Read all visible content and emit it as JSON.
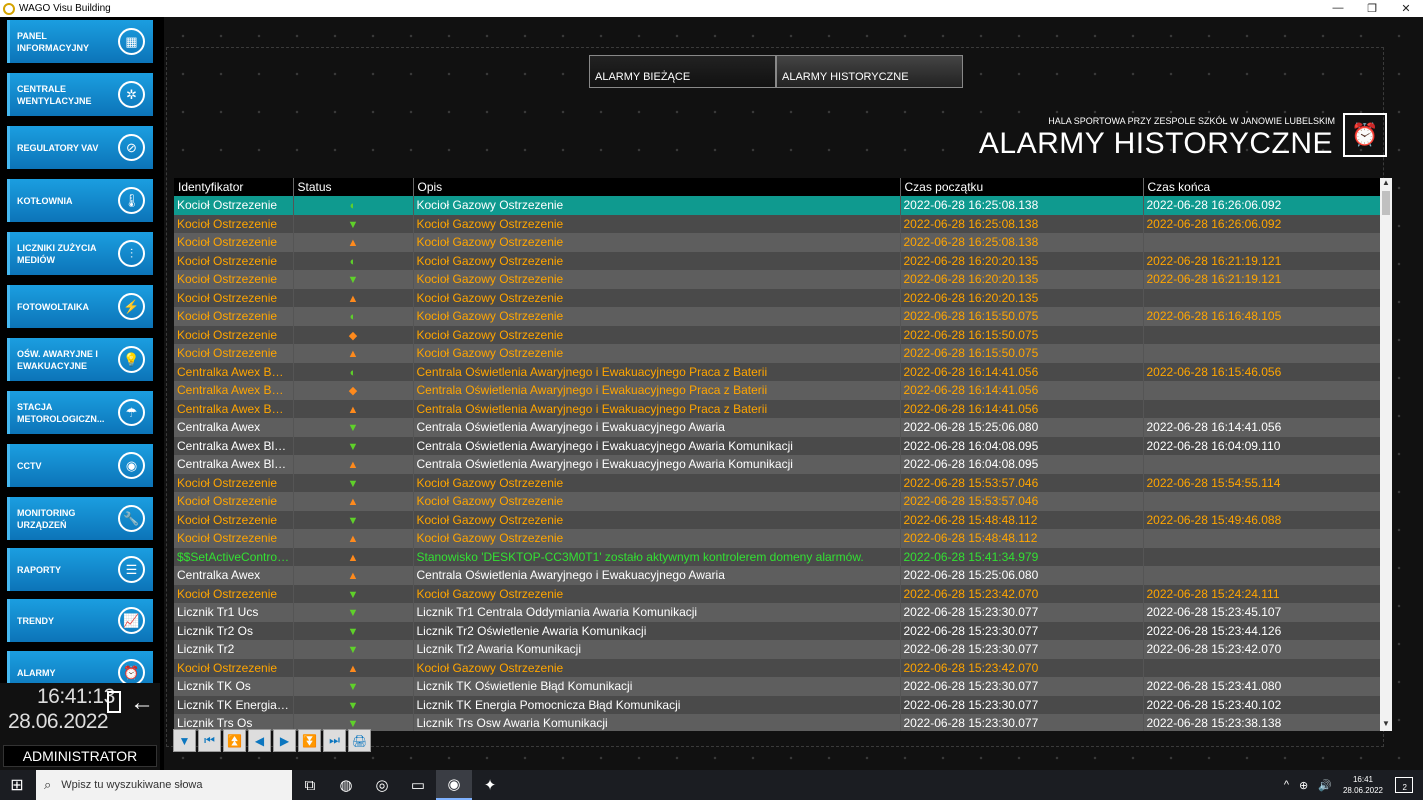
{
  "window": {
    "title": "WAGO Visu Building"
  },
  "sidebar": {
    "items": [
      {
        "label": "PANEL INFORMACYJNY",
        "icon": "dashboard-icon",
        "glyph": "▦"
      },
      {
        "label": "CENTRALE WENTYLACYJNE",
        "icon": "fan-icon",
        "glyph": "✲"
      },
      {
        "label": "REGULATORY VAV",
        "icon": "damper-icon",
        "glyph": "⊘"
      },
      {
        "label": "KOTŁOWNIA",
        "icon": "thermometer-icon",
        "glyph": "🌡"
      },
      {
        "label": "LICZNIKI ZUŻYCIA MEDIÓW",
        "icon": "meter-icon",
        "glyph": "⫶"
      },
      {
        "label": "FOTOWOLTAIKA",
        "icon": "lightning-icon",
        "glyph": "⚡"
      },
      {
        "label": "OŚW. AWARYJNE I EWAKUACYJNE",
        "icon": "bulb-icon",
        "glyph": "💡"
      },
      {
        "label": "STACJA METOROLOGICZN...",
        "icon": "weather-icon",
        "glyph": "☂"
      },
      {
        "label": "CCTV",
        "icon": "camera-icon",
        "glyph": "◉"
      },
      {
        "label": "MONITORING URZĄDZEŃ",
        "icon": "wrench-icon",
        "glyph": "🔧"
      },
      {
        "label": "RAPORTY",
        "icon": "list-icon",
        "glyph": "☰"
      },
      {
        "label": "TRENDY",
        "icon": "trend-icon",
        "glyph": "📈"
      },
      {
        "label": "ALARMY",
        "icon": "alarm-icon",
        "glyph": "⏰"
      }
    ],
    "clock_time": "16:41:13",
    "clock_date": "28.06.2022",
    "user": "ADMINISTRATOR"
  },
  "tabs": [
    {
      "label": "ALARMY BIEŻĄCE"
    },
    {
      "label": "ALARMY HISTORYCZNE"
    }
  ],
  "header": {
    "subtitle": "HALA SPORTOWA PRZY ZESPOLE SZKÓŁ W JANOWIE LUBELSKIM",
    "title": "ALARMY HISTORYCZNE"
  },
  "table": {
    "columns": [
      "Identyfikator",
      "Status",
      "Opis",
      "Czas początku",
      "Czas końca"
    ],
    "rows": [
      {
        "id": "Kocioł Ostrzezenie",
        "status": "ack",
        "opis": "Kocioł Gazowy Ostrzezenie",
        "start": "2022-06-28 16:25:08.138",
        "end": "2022-06-28 16:26:06.092",
        "color": "#ffffff",
        "selected": true
      },
      {
        "id": "Kocioł Ostrzezenie",
        "status": "down",
        "opis": "Kocioł Gazowy Ostrzezenie",
        "start": "2022-06-28 16:25:08.138",
        "end": "2022-06-28 16:26:06.092",
        "color": "#ffa500"
      },
      {
        "id": "Kocioł Ostrzezenie",
        "status": "up",
        "opis": "Kocioł Gazowy Ostrzezenie",
        "start": "2022-06-28 16:25:08.138",
        "end": "",
        "color": "#ffa500"
      },
      {
        "id": "Kocioł Ostrzezenie",
        "status": "ack",
        "opis": "Kocioł Gazowy Ostrzezenie",
        "start": "2022-06-28 16:20:20.135",
        "end": "2022-06-28 16:21:19.121",
        "color": "#ffa500"
      },
      {
        "id": "Kocioł Ostrzezenie",
        "status": "down",
        "opis": "Kocioł Gazowy Ostrzezenie",
        "start": "2022-06-28 16:20:20.135",
        "end": "2022-06-28 16:21:19.121",
        "color": "#ffa500"
      },
      {
        "id": "Kocioł Ostrzezenie",
        "status": "up",
        "opis": "Kocioł Gazowy Ostrzezenie",
        "start": "2022-06-28 16:20:20.135",
        "end": "",
        "color": "#ffa500"
      },
      {
        "id": "Kocioł Ostrzezenie",
        "status": "ack",
        "opis": "Kocioł Gazowy Ostrzezenie",
        "start": "2022-06-28 16:15:50.075",
        "end": "2022-06-28 16:16:48.105",
        "color": "#ffa500"
      },
      {
        "id": "Kocioł Ostrzezenie",
        "status": "upack",
        "opis": "Kocioł Gazowy Ostrzezenie",
        "start": "2022-06-28 16:15:50.075",
        "end": "",
        "color": "#ffa500"
      },
      {
        "id": "Kocioł Ostrzezenie",
        "status": "up",
        "opis": "Kocioł Gazowy Ostrzezenie",
        "start": "2022-06-28 16:15:50.075",
        "end": "",
        "color": "#ffa500"
      },
      {
        "id": "Centralka Awex Bat...",
        "status": "ack",
        "opis": "Centrala Oświetlenia Awaryjnego i Ewakuacyjnego Praca z Baterii",
        "start": "2022-06-28 16:14:41.056",
        "end": "2022-06-28 16:15:46.056",
        "color": "#ffa500"
      },
      {
        "id": "Centralka Awex Bat...",
        "status": "upack",
        "opis": "Centrala Oświetlenia Awaryjnego i Ewakuacyjnego Praca z Baterii",
        "start": "2022-06-28 16:14:41.056",
        "end": "",
        "color": "#ffa500"
      },
      {
        "id": "Centralka Awex Bat...",
        "status": "up",
        "opis": "Centrala Oświetlenia Awaryjnego i Ewakuacyjnego Praca z Baterii",
        "start": "2022-06-28 16:14:41.056",
        "end": "",
        "color": "#ffa500"
      },
      {
        "id": "Centralka Awex",
        "status": "down",
        "opis": "Centrala Oświetlenia Awaryjnego i Ewakuacyjnego Awaria",
        "start": "2022-06-28 15:25:06.080",
        "end": "2022-06-28 16:14:41.056",
        "color": "#ffffff"
      },
      {
        "id": "Centralka Awex Bla...",
        "status": "down",
        "opis": "Centrala Oświetlenia Awaryjnego i Ewakuacyjnego Awaria Komunikacji",
        "start": "2022-06-28 16:04:08.095",
        "end": "2022-06-28 16:04:09.110",
        "color": "#ffffff"
      },
      {
        "id": "Centralka Awex Bla...",
        "status": "up",
        "opis": "Centrala Oświetlenia Awaryjnego i Ewakuacyjnego Awaria Komunikacji",
        "start": "2022-06-28 16:04:08.095",
        "end": "",
        "color": "#ffffff"
      },
      {
        "id": "Kocioł Ostrzezenie",
        "status": "down",
        "opis": "Kocioł Gazowy Ostrzezenie",
        "start": "2022-06-28 15:53:57.046",
        "end": "2022-06-28 15:54:55.114",
        "color": "#ffa500"
      },
      {
        "id": "Kocioł Ostrzezenie",
        "status": "up",
        "opis": "Kocioł Gazowy Ostrzezenie",
        "start": "2022-06-28 15:53:57.046",
        "end": "",
        "color": "#ffa500"
      },
      {
        "id": "Kocioł Ostrzezenie",
        "status": "down",
        "opis": "Kocioł Gazowy Ostrzezenie",
        "start": "2022-06-28 15:48:48.112",
        "end": "2022-06-28 15:49:46.088",
        "color": "#ffa500"
      },
      {
        "id": "Kocioł Ostrzezenie",
        "status": "up",
        "opis": "Kocioł Gazowy Ostrzezenie",
        "start": "2022-06-28 15:48:48.112",
        "end": "",
        "color": "#ffa500"
      },
      {
        "id": "$$SetActiveControl...",
        "status": "up",
        "opis": "Stanowisko 'DESKTOP-CC3M0T1' zostało aktywnym kontrolerem domeny alarmów.",
        "start": "2022-06-28 15:41:34.979",
        "end": "",
        "color": "#33e033"
      },
      {
        "id": "Centralka Awex",
        "status": "up",
        "opis": "Centrala Oświetlenia Awaryjnego i Ewakuacyjnego Awaria",
        "start": "2022-06-28 15:25:06.080",
        "end": "",
        "color": "#ffffff"
      },
      {
        "id": "Kocioł Ostrzezenie",
        "status": "down",
        "opis": "Kocioł Gazowy Ostrzezenie",
        "start": "2022-06-28 15:23:42.070",
        "end": "2022-06-28 15:24:24.111",
        "color": "#ffa500"
      },
      {
        "id": "Licznik Tr1 Ucs",
        "status": "down",
        "opis": "Licznik Tr1 Centrala Oddymiania Awaria Komunikacji",
        "start": "2022-06-28 15:23:30.077",
        "end": "2022-06-28 15:23:45.107",
        "color": "#ffffff"
      },
      {
        "id": "Licznik Tr2 Os",
        "status": "down",
        "opis": "Licznik Tr2 Oświetlenie Awaria Komunikacji",
        "start": "2022-06-28 15:23:30.077",
        "end": "2022-06-28 15:23:44.126",
        "color": "#ffffff"
      },
      {
        "id": "Licznik Tr2",
        "status": "down",
        "opis": "Licznik Tr2 Awaria Komunikacji",
        "start": "2022-06-28 15:23:30.077",
        "end": "2022-06-28 15:23:42.070",
        "color": "#ffffff"
      },
      {
        "id": "Kocioł Ostrzezenie",
        "status": "up",
        "opis": "Kocioł Gazowy Ostrzezenie",
        "start": "2022-06-28 15:23:42.070",
        "end": "",
        "color": "#ffa500"
      },
      {
        "id": "Licznik TK Os",
        "status": "down",
        "opis": "Licznik TK Oświetlenie Błąd Komunikacji",
        "start": "2022-06-28 15:23:30.077",
        "end": "2022-06-28 15:23:41.080",
        "color": "#ffffff"
      },
      {
        "id": "Licznik TK Energia ...",
        "status": "down",
        "opis": "Licznik TK Energia Pomocnicza Błąd Komunikacji",
        "start": "2022-06-28 15:23:30.077",
        "end": "2022-06-28 15:23:40.102",
        "color": "#ffffff"
      },
      {
        "id": "Licznik Trs Os",
        "status": "down",
        "opis": "Licznik Trs Osw Awaria Komunikacji",
        "start": "2022-06-28 15:23:30.077",
        "end": "2022-06-28 15:23:38.138",
        "color": "#ffffff"
      }
    ]
  },
  "toolbar": {
    "buttons": [
      {
        "name": "filter-icon",
        "glyph": "▼"
      },
      {
        "name": "first-page-icon",
        "glyph": "⏮"
      },
      {
        "name": "page-up-icon",
        "glyph": "⏫"
      },
      {
        "name": "prev-icon",
        "glyph": "◀"
      },
      {
        "name": "next-icon",
        "glyph": "▶"
      },
      {
        "name": "page-down-icon",
        "glyph": "⏬"
      },
      {
        "name": "last-page-icon",
        "glyph": "⏭"
      },
      {
        "name": "print-icon",
        "glyph": "🖨"
      }
    ]
  },
  "taskbar": {
    "search_placeholder": "Wpisz tu wyszukiwane słowa",
    "time": "16:41",
    "date": "28.06.2022",
    "notifications": "2"
  },
  "colors": {
    "accent": "#0c74b8",
    "selected_row": "#0f9a8f",
    "status_green": "#5fd12a",
    "status_orange": "#ff8a1c"
  }
}
